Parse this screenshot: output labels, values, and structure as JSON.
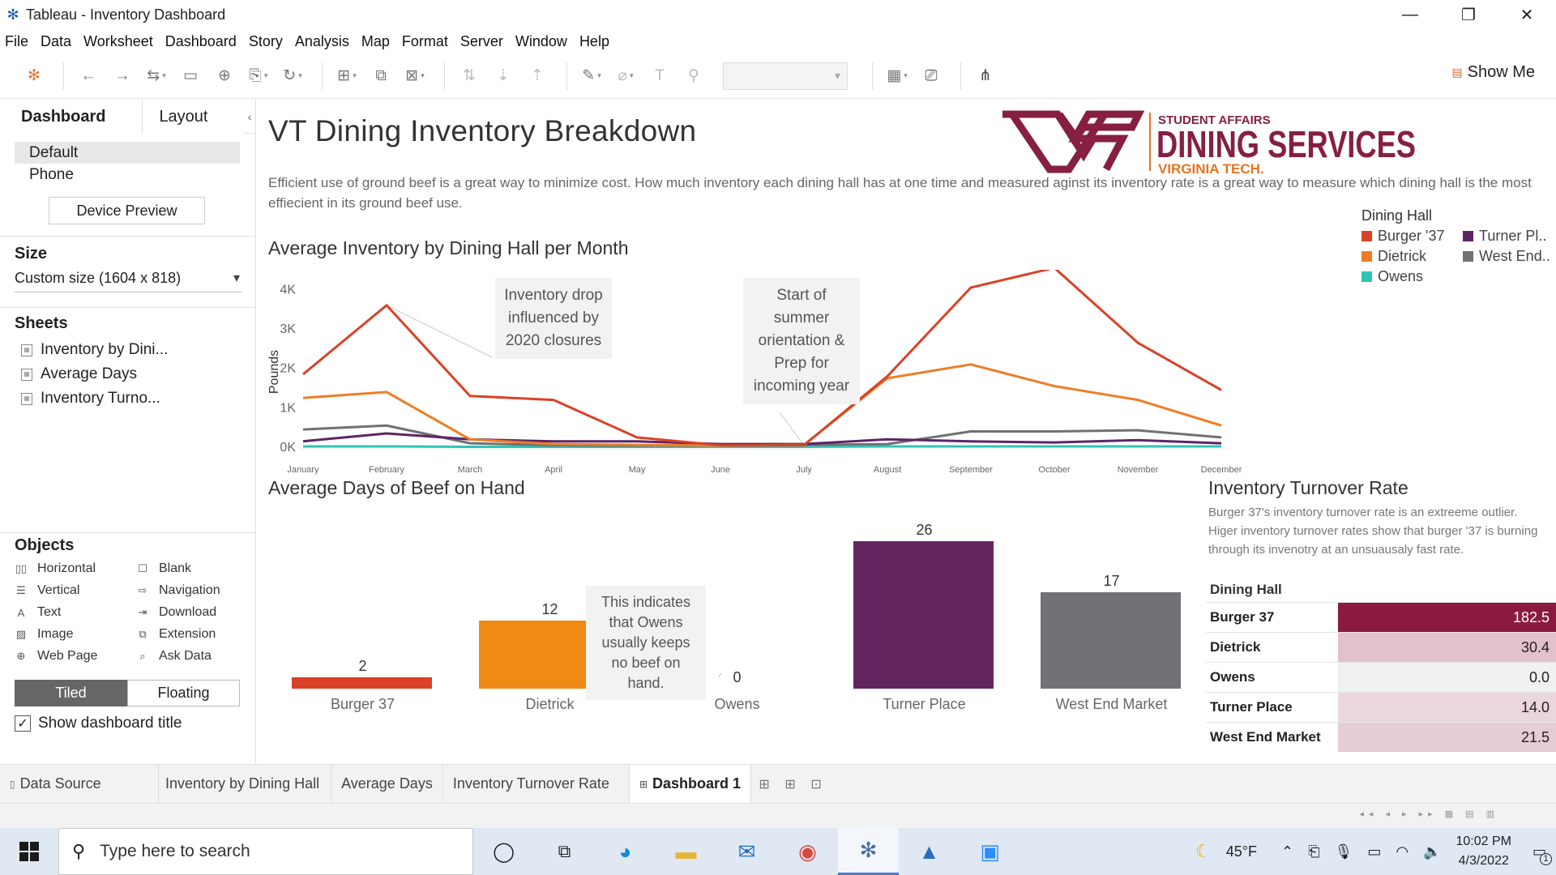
{
  "window": {
    "title": "Tableau - Inventory Dashboard",
    "controls": [
      "—",
      "❐",
      "✕"
    ]
  },
  "menu": [
    "File",
    "Data",
    "Worksheet",
    "Dashboard",
    "Story",
    "Analysis",
    "Map",
    "Format",
    "Server",
    "Window",
    "Help"
  ],
  "toolbar": {
    "show_me": "Show Me"
  },
  "left_panel": {
    "tab_dashboard": "Dashboard",
    "tab_layout": "Layout",
    "collapse_icon": "‹",
    "devices": [
      "Default",
      "Phone"
    ],
    "device_preview": "Device Preview",
    "size_title": "Size",
    "size_value": "Custom size (1604 x 818)",
    "sheets_title": "Sheets",
    "sheets": [
      "Inventory by Dini...",
      "Average Days",
      "Inventory Turno..."
    ],
    "objects_title": "Objects",
    "objects": [
      {
        "label": "Horizontal",
        "icon": "▯▯"
      },
      {
        "label": "Blank",
        "icon": "☐"
      },
      {
        "label": "Vertical",
        "icon": "☰"
      },
      {
        "label": "Navigation",
        "icon": "⇨"
      },
      {
        "label": "Text",
        "icon": "A"
      },
      {
        "label": "Download",
        "icon": "⇥"
      },
      {
        "label": "Image",
        "icon": "▨"
      },
      {
        "label": "Extension",
        "icon": "⧉"
      },
      {
        "label": "Web Page",
        "icon": "⊕"
      },
      {
        "label": "Ask Data",
        "icon": "⌕"
      }
    ],
    "tiled": "Tiled",
    "floating": "Floating",
    "show_title_check": "✓",
    "show_title": "Show dashboard title"
  },
  "dashboard": {
    "title": "VT Dining Inventory Breakdown",
    "description": "Efficient use of ground beef is a great way to minimize cost. How much inventory each dining hall has at one time and measured aginst its inventory rate is a great way to measure which dining hall is the most effiecient in its ground beef use.",
    "logo": {
      "monogram": "VT",
      "line1": "STUDENT AFFAIRS",
      "line2": "DINING SERVICES",
      "line3": "VIRGINIA TECH."
    },
    "legend_title": "Dining Hall",
    "legend": [
      {
        "name": "Burger '37",
        "color": "#d94227"
      },
      {
        "name": "Turner Pl..",
        "color": "#5e2465"
      },
      {
        "name": "Dietrick",
        "color": "#ee7d25"
      },
      {
        "name": "West End..",
        "color": "#6f7174"
      },
      {
        "name": "Owens",
        "color": "#2ec4b6"
      }
    ],
    "line_chart_title": "Average Inventory by Dining Hall per Month",
    "annotation_1": "Inventory drop influenced by 2020 closures",
    "annotation_2": "Start of summer orientation & Prep for incoming year",
    "bar_chart_title": "Average Days of Beef on Hand",
    "annotation_3": "This indicates that Owens usually keeps no beef on hand.",
    "turnover": {
      "title": "Inventory Turnover Rate",
      "description": "Burger 37's inventory turnover rate is an extreeme outlier. Higer inventory turnover rates show that burger '37  is burning through its invenotry at an unsuausaly fast rate.",
      "column_header": "Dining Hall",
      "rows": [
        {
          "name": "Burger 37",
          "value": "182.5",
          "bg": "#8b1a3e",
          "fg": "#ffffff"
        },
        {
          "name": "Dietrick",
          "value": "30.4",
          "bg": "#e3c1cb",
          "fg": "#222222"
        },
        {
          "name": "Owens",
          "value": "0.0",
          "bg": "#f0f0f0",
          "fg": "#222222"
        },
        {
          "name": "Turner Place",
          "value": "14.0",
          "bg": "#ead6dc",
          "fg": "#222222"
        },
        {
          "name": "West End Market",
          "value": "21.5",
          "bg": "#e6ccd4",
          "fg": "#222222"
        }
      ]
    }
  },
  "chart_data": [
    {
      "type": "line",
      "title": "Average Inventory by Dining Hall per Month",
      "ylabel": "Pounds",
      "xlabel": "",
      "x": [
        "January",
        "February",
        "March",
        "April",
        "May",
        "June",
        "July",
        "August",
        "September",
        "October",
        "November",
        "December"
      ],
      "yticks": [
        "0K",
        "1K",
        "2K",
        "3K",
        "4K"
      ],
      "ylim": [
        0,
        4500
      ],
      "grid": false,
      "legend_position": "top-right",
      "series": [
        {
          "name": "Burger '37",
          "color": "#d94227",
          "values": [
            1850,
            3600,
            1300,
            1200,
            250,
            50,
            50,
            1800,
            4050,
            4550,
            2650,
            1450
          ]
        },
        {
          "name": "Dietrick",
          "color": "#ee7d25",
          "values": [
            1250,
            1400,
            200,
            80,
            60,
            40,
            60,
            1750,
            2100,
            1550,
            1200,
            550
          ]
        },
        {
          "name": "Owens",
          "color": "#2ec4b6",
          "values": [
            20,
            20,
            10,
            10,
            10,
            10,
            10,
            20,
            20,
            20,
            20,
            20
          ]
        },
        {
          "name": "Turner Place",
          "color": "#5e2465",
          "values": [
            150,
            350,
            200,
            150,
            150,
            80,
            80,
            200,
            150,
            120,
            180,
            100
          ]
        },
        {
          "name": "West End Market",
          "color": "#6f7174",
          "values": [
            450,
            550,
            100,
            50,
            40,
            40,
            60,
            80,
            400,
            400,
            430,
            250
          ]
        }
      ]
    },
    {
      "type": "bar",
      "title": "Average Days of Beef on Hand",
      "categories": [
        "Burger 37",
        "Dietrick",
        "Owens",
        "Turner Place",
        "West End Market"
      ],
      "values": [
        2,
        12,
        0,
        26,
        17
      ],
      "colors": [
        "#d94227",
        "#ef8a14",
        "#2ec4b6",
        "#63255f",
        "#707275"
      ],
      "ylim": [
        0,
        26
      ]
    },
    {
      "type": "table",
      "title": "Inventory Turnover Rate",
      "columns": [
        "Dining Hall",
        "Inventory Turnover Rate"
      ],
      "rows": [
        [
          "Burger 37",
          182.5
        ],
        [
          "Dietrick",
          30.4
        ],
        [
          "Owens",
          0.0
        ],
        [
          "Turner Place",
          14.0
        ],
        [
          "West End Market",
          21.5
        ]
      ]
    }
  ],
  "sheet_tabs": {
    "data_source": "Data Source",
    "tabs": [
      "Inventory by Dining Hall",
      "Average Days",
      "Inventory Turnover Rate"
    ],
    "active": "Dashboard 1"
  },
  "taskbar": {
    "search_placeholder": "Type here to search",
    "weather": "45°F",
    "time": "10:02 PM",
    "date": "4/3/2022",
    "notification_count": "1"
  }
}
